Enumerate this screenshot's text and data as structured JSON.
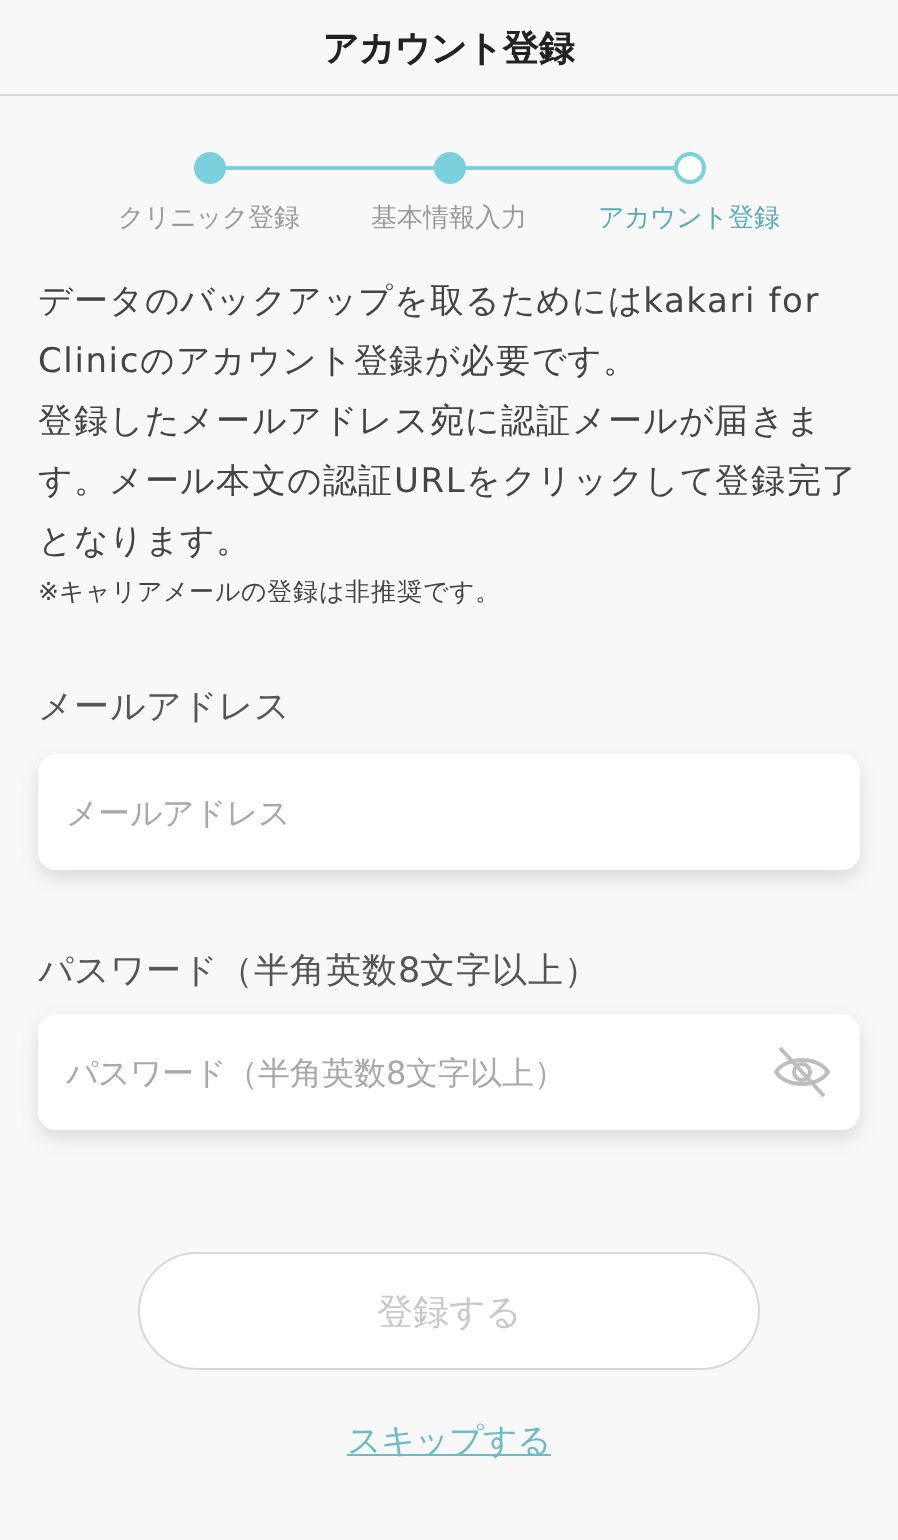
{
  "header": {
    "title": "アカウント登録"
  },
  "steps": [
    {
      "label": "クリニック登録",
      "done": true,
      "selected": false
    },
    {
      "label": "基本情報入力",
      "done": true,
      "selected": false
    },
    {
      "label": "アカウント登録",
      "done": false,
      "selected": true
    }
  ],
  "intro": [
    "データのバックアップを取るためにはkakari for Clinicのアカウント登録が必要です。",
    "登録したメールアドレス宛に認証メールが届きます。メール本文の認証URLをクリックして登録完了となります。"
  ],
  "note": "※キャリアメールの登録は非推奨です。",
  "email": {
    "label": "メールアドレス",
    "placeholder": "メールアドレス"
  },
  "password": {
    "label": "パスワード（半角英数8文字以上）",
    "placeholder": "パスワード（半角英数8文字以上）",
    "visible": false
  },
  "submit": {
    "label": "登録する",
    "disabled": true
  },
  "skip": {
    "label": "スキップする"
  }
}
